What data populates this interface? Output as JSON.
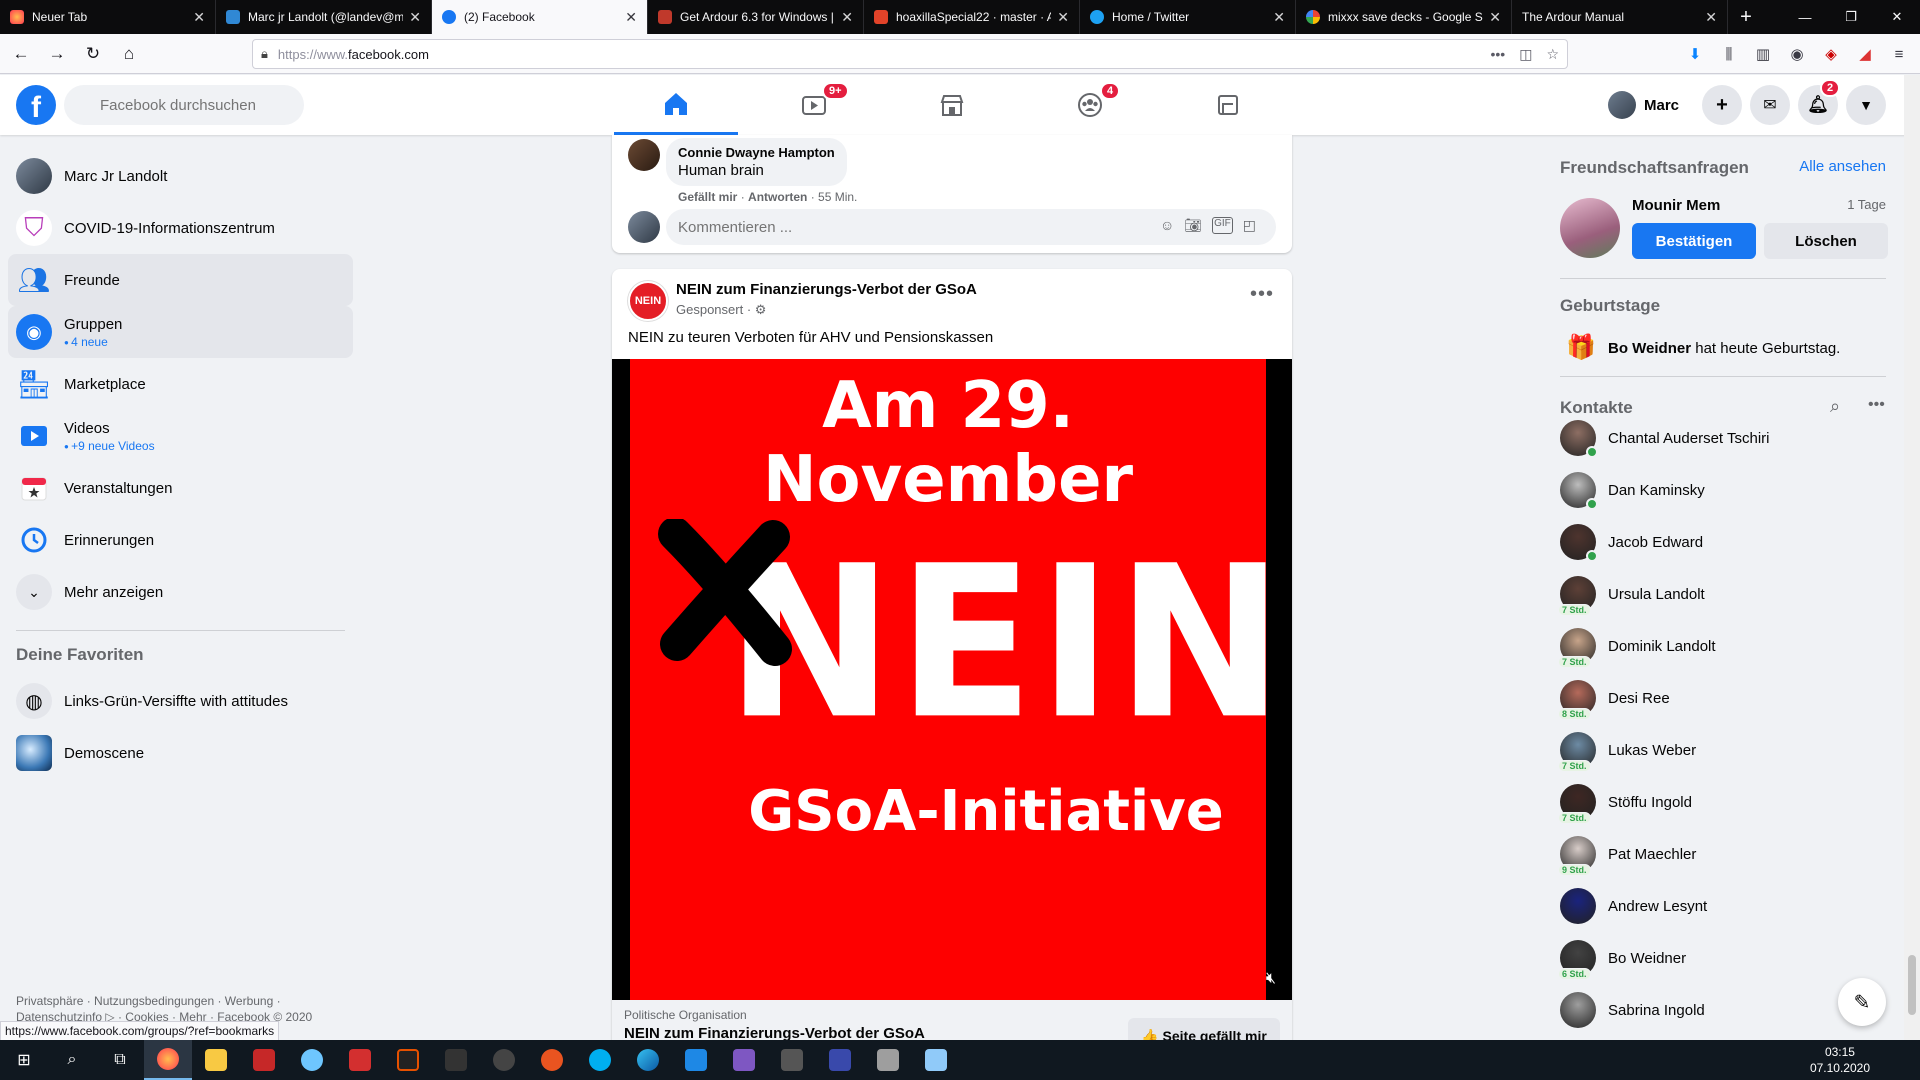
{
  "browser": {
    "tabs": [
      {
        "title": "Neuer Tab",
        "color": "#ff7139"
      },
      {
        "title": "Marc jr Landolt (@landev@m",
        "color": "#3088d4"
      },
      {
        "title": "(2) Facebook",
        "color": "#1877f2"
      },
      {
        "title": "Get Ardour 6.3 for Windows |",
        "color": "#c0392b"
      },
      {
        "title": "hoaxillaSpecial22 · master · A",
        "color": "#e24329"
      },
      {
        "title": "Home / Twitter",
        "color": "#1da1f2"
      },
      {
        "title": "mixxx save decks - Google S",
        "color": "#4285f4"
      },
      {
        "title": "The Ardour Manual",
        "color": "#777777"
      }
    ],
    "url_proto": "https://www.",
    "url_host": "facebook.com",
    "status_url": "https://www.facebook.com/groups/?ref=bookmarks"
  },
  "fb": {
    "search_placeholder": "Facebook durchsuchen",
    "watch_badge": "9+",
    "groups_badge": "4",
    "profile_name": "Marc",
    "notif_badge": "2"
  },
  "leftnav": {
    "items": [
      {
        "label": "Marc Jr Landolt"
      },
      {
        "label": "COVID-19-Informationszentrum"
      },
      {
        "label": "Freunde"
      },
      {
        "label": "Gruppen",
        "sub": "4 neue"
      },
      {
        "label": "Marketplace"
      },
      {
        "label": "Videos",
        "sub": "+9 neue Videos"
      },
      {
        "label": "Veranstaltungen"
      },
      {
        "label": "Erinnerungen"
      },
      {
        "label": "Mehr anzeigen"
      }
    ],
    "favorites_title": "Deine Favoriten",
    "favorites": [
      {
        "label": "Links-Grün-Versiffte with attitudes"
      },
      {
        "label": "Demoscene"
      }
    ],
    "footer": "Privatsphäre · Nutzungsbedingungen · Werbung · Datenschutzinfo ▷ · Cookies · Mehr · Facebook © 2020"
  },
  "comment": {
    "author": "Connie Dwayne Hampton",
    "text": "Human brain",
    "like": "Gefällt mir",
    "reply": "Antworten",
    "age": "55 Min.",
    "input_placeholder": "Kommentieren ..."
  },
  "post": {
    "page": "NEIN zum Finanzierungs-Verbot der GSoA",
    "avatar_text": "NEIN",
    "sponsored": "Gesponsert · ⚙",
    "text": "NEIN zu teuren Verboten für AHV und Pensionskassen",
    "image_line1": "Am 29. November",
    "image_line2": "NEIN",
    "image_line3": "GSoA-Initiative",
    "category": "Politische Organisation",
    "page_name_footer": "NEIN zum Finanzierungs-Verbot der GSoA",
    "like_button": "👍 Seite gefällt mir"
  },
  "right": {
    "friend_requests_title": "Freundschaftsanfragen",
    "see_all": "Alle ansehen",
    "request_name": "Mounir Mem",
    "request_time": "1 Tage",
    "confirm": "Bestätigen",
    "delete": "Löschen",
    "birthdays_title": "Geburtstage",
    "birthday_name": "Bo Weidner",
    "birthday_text": " hat heute Geburtstag.",
    "contacts_title": "Kontakte",
    "contacts": [
      {
        "name": "Chantal Auderset Tschiri",
        "status": "online"
      },
      {
        "name": "Dan Kaminsky",
        "status": "online"
      },
      {
        "name": "Jacob Edward",
        "status": "online"
      },
      {
        "name": "Ursula Landolt",
        "status": "7 Std."
      },
      {
        "name": "Dominik Landolt",
        "status": "7 Std."
      },
      {
        "name": "Desi Ree",
        "status": "8 Std."
      },
      {
        "name": "Lukas Weber",
        "status": "7 Std."
      },
      {
        "name": "Stöffu Ingold",
        "status": "7 Std."
      },
      {
        "name": "Pat Maechler",
        "status": "9 Std."
      },
      {
        "name": "Andrew Lesynt",
        "status": ""
      },
      {
        "name": "Bo Weidner",
        "status": "6 Std."
      },
      {
        "name": "Sabrina Ingold",
        "status": ""
      }
    ]
  },
  "taskbar": {
    "time": "03:15",
    "date": "07.10.2020"
  }
}
